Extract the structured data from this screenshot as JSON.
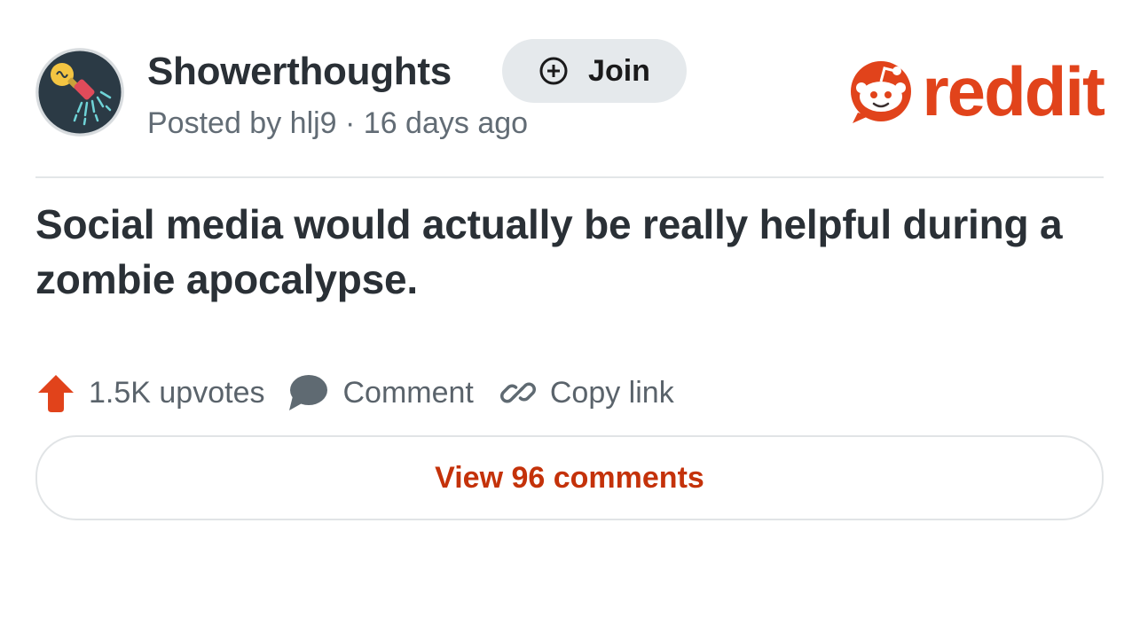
{
  "post": {
    "subreddit": "Showerthoughts",
    "join_label": "Join",
    "meta": "Posted by hlj9 · 16 days ago",
    "title": "Social media would actually be really helpful during a zombie apocalypse.",
    "upvotes_label": "1.5K upvotes",
    "comment_label": "Comment",
    "copy_link_label": "Copy link",
    "view_comments_label": "View 96 comments"
  },
  "brand": {
    "logo_text": "reddit",
    "accent_color": "#e1431b",
    "link_color": "#c4320a"
  },
  "icons": {
    "avatar": "lightbulb-shower-icon",
    "join": "plus-circle-icon",
    "upvote": "upvote-arrow-icon",
    "comment": "speech-bubble-icon",
    "copy_link": "link-icon",
    "logo": "reddit-snoo-icon"
  }
}
